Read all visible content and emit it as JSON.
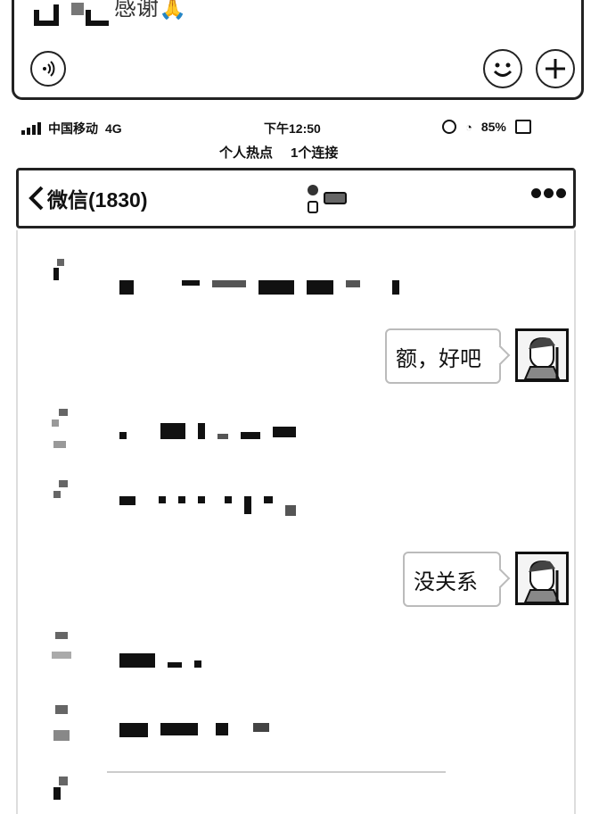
{
  "composer": {
    "last_message": "感谢🙏",
    "voice_icon": "voice-icon",
    "emoji_icon": "emoji-icon",
    "plus_icon": "plus-icon"
  },
  "status_bar": {
    "carrier": "中国移动",
    "network": "4G",
    "time": "下午12:50",
    "battery": "85%"
  },
  "banner": {
    "left": "个人热点",
    "right": "1个连接"
  },
  "nav": {
    "back_label": "微信(1830)",
    "more_icon": "more-icon"
  },
  "messages": [
    {
      "side": "left",
      "text": ""
    },
    {
      "side": "right",
      "text": "额，好吧"
    },
    {
      "side": "left",
      "text": ""
    },
    {
      "side": "left",
      "text": ""
    },
    {
      "side": "right",
      "text": "没关系"
    },
    {
      "side": "left",
      "text": ""
    },
    {
      "side": "left",
      "text": ""
    },
    {
      "side": "left",
      "text": ""
    }
  ]
}
